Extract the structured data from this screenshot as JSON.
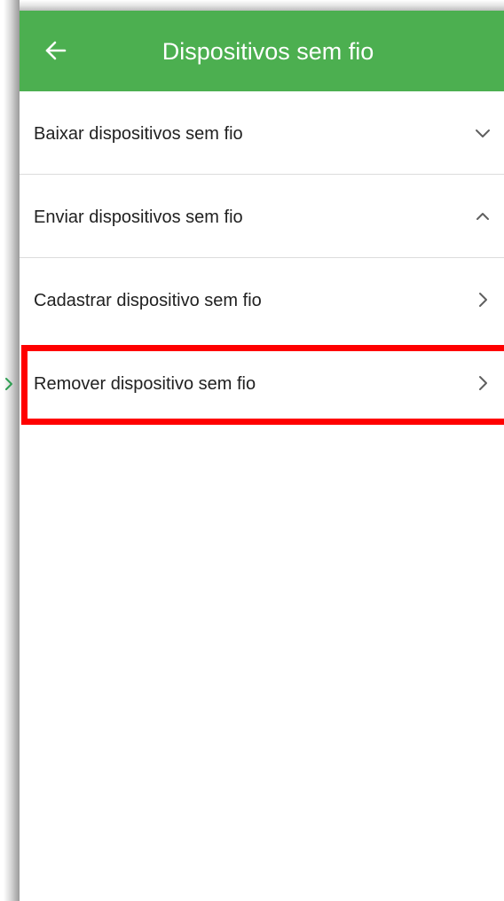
{
  "app_bar": {
    "title": "Dispositivos sem fio",
    "back_icon": "arrow-left-icon",
    "background_color": "#4caf50"
  },
  "menu": {
    "items": [
      {
        "label": "Baixar dispositivos sem fio",
        "icon": "chevron-down-icon"
      },
      {
        "label": "Enviar dispositivos sem fio",
        "icon": "chevron-up-icon"
      },
      {
        "label": "Cadastrar dispositivo sem fio",
        "icon": "chevron-right-icon"
      },
      {
        "label": "Remover dispositivo sem fio",
        "icon": "chevron-right-icon"
      }
    ]
  },
  "annotation": {
    "highlight_color": "#ff0000",
    "highlighted_item": "Remover dispositivo sem fio",
    "pointer_color": "#2e9e52"
  }
}
